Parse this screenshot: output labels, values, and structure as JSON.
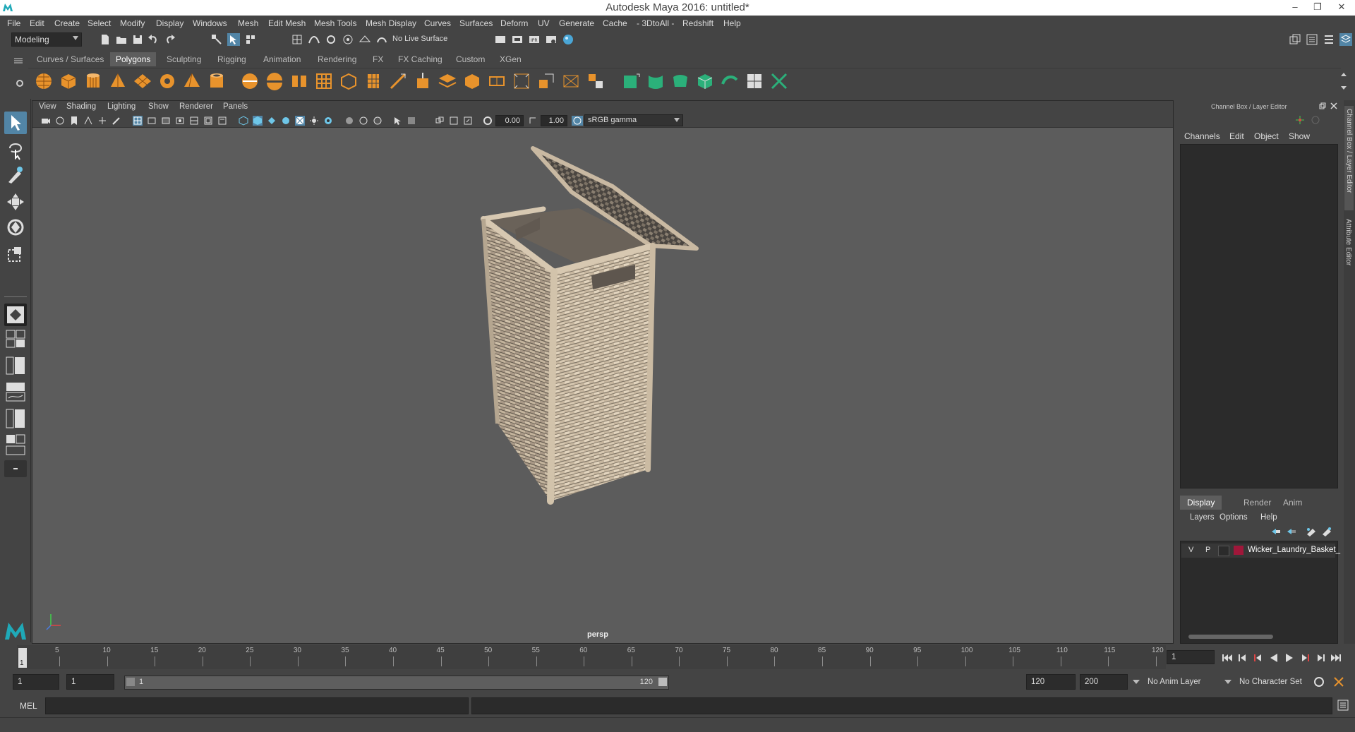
{
  "window": {
    "title": "Autodesk Maya 2016: untitled*",
    "minimize": "–",
    "restore": "❐",
    "close": "✕"
  },
  "menubar": {
    "items": [
      "File",
      "Edit",
      "Create",
      "Select",
      "Modify",
      "Display",
      "Windows",
      "Mesh",
      "Edit Mesh",
      "Mesh Tools",
      "Mesh Display",
      "Curves",
      "Surfaces",
      "Deform",
      "UV",
      "Generate",
      "Cache",
      "- 3DtoAll -",
      "Redshift",
      "Help"
    ]
  },
  "statusline": {
    "mode": "Modeling",
    "live_surface": "No Live Surface"
  },
  "shelf": {
    "tabs": [
      "Curves / Surfaces",
      "Polygons",
      "Sculpting",
      "Rigging",
      "Animation",
      "Rendering",
      "FX",
      "FX Caching",
      "Custom",
      "XGen"
    ],
    "active_tab": "Polygons"
  },
  "viewport": {
    "menu": [
      "View",
      "Shading",
      "Lighting",
      "Show",
      "Renderer",
      "Panels"
    ],
    "exposure": "0.00",
    "gamma": "1.00",
    "color_space": "sRGB gamma",
    "camera_label": "persp"
  },
  "channel_box": {
    "title": "Channel Box / Layer Editor",
    "menu": [
      "Channels",
      "Edit",
      "Object",
      "Show"
    ]
  },
  "layer_editor": {
    "tabs": [
      "Display",
      "Render",
      "Anim"
    ],
    "active_tab": "Display",
    "menu": [
      "Layers",
      "Options",
      "Help"
    ],
    "layer": {
      "v": "V",
      "p": "P",
      "name": "Wicker_Laundry_Basket_",
      "color": "#a0173a"
    }
  },
  "side_tabs": {
    "channel_box": "Channel Box / Layer Editor",
    "attribute_editor": "Attribute Editor"
  },
  "timeslider": {
    "ticks": [
      "5",
      "10",
      "15",
      "20",
      "25",
      "30",
      "35",
      "40",
      "45",
      "50",
      "55",
      "60",
      "65",
      "70",
      "75",
      "80",
      "85",
      "90",
      "95",
      "100",
      "105",
      "110",
      "115",
      "120"
    ],
    "start_frame": "1",
    "current_frame": "1"
  },
  "range": {
    "start": "1",
    "playback_start": "1",
    "slider_start": "1",
    "slider_end": "120",
    "playback_end": "120",
    "end": "200",
    "anim_layer": "No Anim Layer",
    "character_set": "No Character Set"
  },
  "command_line": {
    "language": "MEL"
  },
  "colors": {
    "accent": "#5285a6",
    "shelf_orange": "#e8932c",
    "shelf_green": "#2bb07a"
  }
}
